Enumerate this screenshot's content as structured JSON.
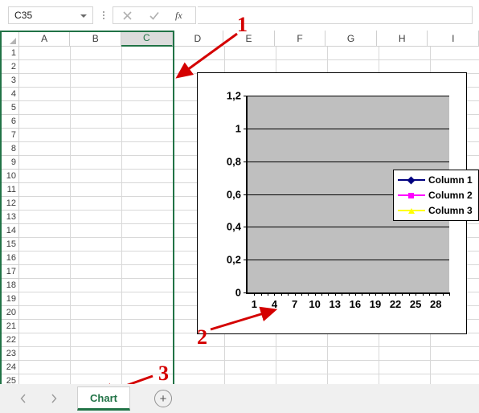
{
  "formula_bar": {
    "name_box_value": "C35",
    "name_box_dropdown_icon": "chevron-down-icon",
    "menu_icon": "vertical-dots-icon",
    "cancel_icon": "cancel-x-icon",
    "confirm_icon": "confirm-check-icon",
    "function_icon": "fx-icon",
    "formula_value": "",
    "formula_placeholder": ""
  },
  "grid": {
    "columns": [
      "A",
      "B",
      "C",
      "D",
      "E",
      "F",
      "G",
      "H",
      "I"
    ],
    "selected_column": "C",
    "rows": [
      "1",
      "2",
      "3",
      "4",
      "5",
      "6",
      "7",
      "8",
      "9",
      "10",
      "11",
      "12",
      "13",
      "14",
      "15",
      "16",
      "17",
      "18",
      "19",
      "20",
      "21",
      "22",
      "23",
      "24",
      "25"
    ],
    "select_all_icon": "select-all-triangle-icon"
  },
  "chart_data": {
    "type": "line",
    "title": "",
    "xlabel": "",
    "ylabel": "",
    "xlim": [
      0,
      30
    ],
    "ylim": [
      0,
      1.2
    ],
    "y_ticks": [
      "0",
      "0,2",
      "0,4",
      "0,6",
      "0,8",
      "1",
      "1,2"
    ],
    "y_tick_values": [
      0,
      0.2,
      0.4,
      0.6,
      0.8,
      1,
      1.2
    ],
    "x_ticks": [
      "1",
      "4",
      "7",
      "10",
      "13",
      "16",
      "19",
      "22",
      "25",
      "28"
    ],
    "x_tick_values": [
      1,
      4,
      7,
      10,
      13,
      16,
      19,
      22,
      25,
      28
    ],
    "grid": true,
    "legend_position": "right",
    "plot_background": "#bfbfbf",
    "series": [
      {
        "name": "Column 1",
        "color": "#000080",
        "marker": "diamond",
        "values": []
      },
      {
        "name": "Column 2",
        "color": "#ff00ff",
        "marker": "square",
        "values": []
      },
      {
        "name": "Column 3",
        "color": "#ffff00",
        "marker": "triangle",
        "values": []
      }
    ]
  },
  "annotations": [
    {
      "label": "1",
      "color": "#d40000"
    },
    {
      "label": "2",
      "color": "#d40000"
    },
    {
      "label": "3",
      "color": "#d40000"
    }
  ],
  "sheet_bar": {
    "prev_icon": "nav-prev-icon",
    "next_icon": "nav-next-icon",
    "tabs": [
      {
        "label": "Chart",
        "active": true
      }
    ],
    "add_sheet_icon": "add-sheet-plus-icon",
    "add_sheet_label": "+"
  },
  "colors": {
    "excel_green": "#217346",
    "annotation_red": "#d40000",
    "plot_gray": "#bfbfbf"
  }
}
